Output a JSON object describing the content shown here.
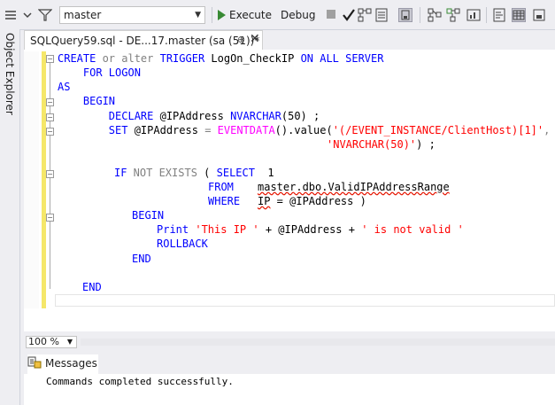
{
  "toolbar": {
    "database": "master",
    "execute_label": "Execute",
    "debug_label": "Debug"
  },
  "side_panel": {
    "label": "Object Explorer"
  },
  "tab": {
    "title": "SQLQuery59.sql - DE...17.master (sa (51))*",
    "pin": "⊕",
    "close": "✕"
  },
  "code": {
    "line1_a": "CREATE",
    "line1_b": " or alter ",
    "line1_c": "TRIGGER",
    "line1_d": " LogOn_CheckIP ",
    "line1_e": "ON ALL SERVER",
    "line2": "    FOR LOGON",
    "line3": "AS",
    "line4": "    BEGIN",
    "line5_a": "        DECLARE",
    "line5_b": " @IPAddress ",
    "line5_c": "NVARCHAR",
    "line5_d": "(50) ;",
    "line6_a": "        SET",
    "line6_b": " @IPAddress ",
    "line6_c": "=",
    "line6_d": " EVENTDATA",
    "line6_e": "().value(",
    "line6_f": "'(/EVENT_INSTANCE/ClientHost)[1]'",
    "line6_g": ",",
    "line7_a": "'NVARCHAR(50)'",
    "line7_b": ") ;",
    "line8_a": "IF",
    "line8_b": " NOT EXISTS",
    "line8_c": " ( ",
    "line8_d": "SELECT",
    "line8_e": "  1",
    "line9_a": "FROM",
    "line9_b": "master.dbo.ValidIPAddressRange",
    "line10_a": "WHERE",
    "line10_b": "IP",
    "line10_c": " = @IPAddress )",
    "line11": "BEGIN",
    "line12_a": "Print",
    "line12_b": "'This IP '",
    "line12_c": " + @IPAddress + ",
    "line12_d": "' is not valid '",
    "line13": "ROLLBACK",
    "line14": "END",
    "line15": "END"
  },
  "zoom": {
    "value": "100 %"
  },
  "results": {
    "tab_label": "Messages",
    "message": "Commands completed successfully."
  }
}
